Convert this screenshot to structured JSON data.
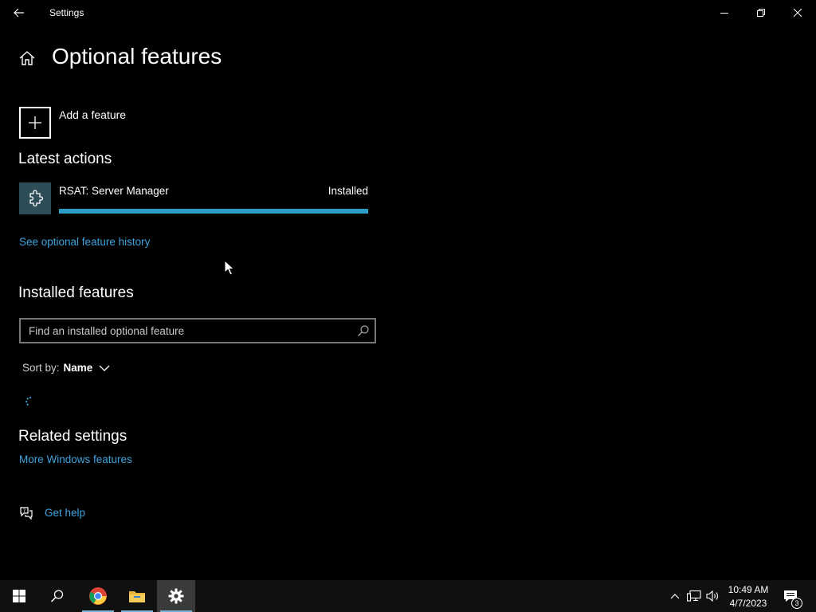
{
  "window": {
    "app_title": "Settings"
  },
  "header": {
    "page_title": "Optional features"
  },
  "add_feature": {
    "label": "Add a feature"
  },
  "latest_actions": {
    "heading": "Latest actions",
    "items": [
      {
        "name": "RSAT: Server Manager",
        "status": "Installed",
        "progress": 1.0
      }
    ],
    "history_link": "See optional feature history"
  },
  "installed_features": {
    "heading": "Installed features",
    "search_placeholder": "Find an installed optional feature",
    "sort_label": "Sort by:",
    "sort_value": "Name"
  },
  "related_settings": {
    "heading": "Related settings",
    "link": "More Windows features"
  },
  "help": {
    "label": "Get help"
  },
  "taskbar": {
    "clock_time": "10:49 AM",
    "clock_date": "4/7/2023",
    "notification_count": "3"
  },
  "colors": {
    "accent": "#3da3dd",
    "progress": "#2a9ec4",
    "tile": "#2d4d57"
  }
}
